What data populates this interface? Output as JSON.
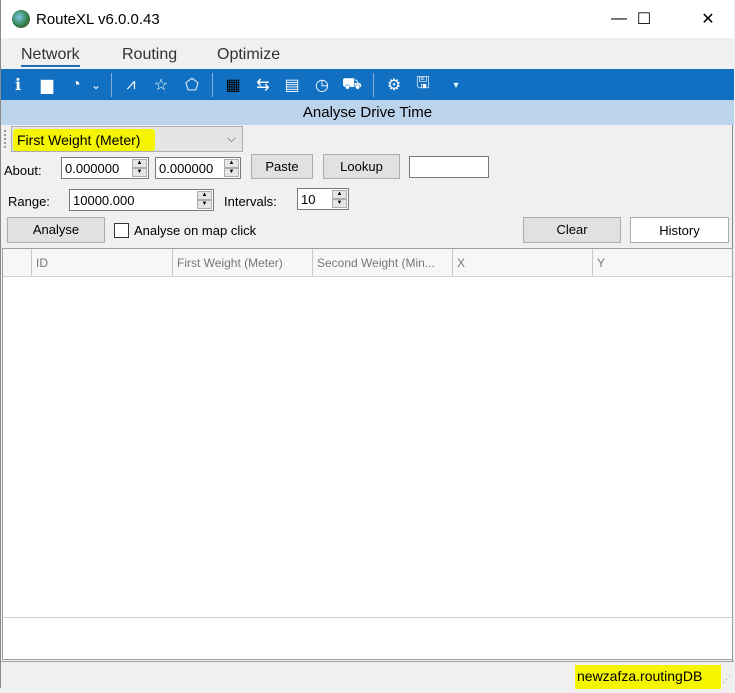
{
  "window": {
    "title": "RouteXL v6.0.0.43",
    "controls": {
      "minimize": "—",
      "maximize": "☐",
      "close": "✕"
    }
  },
  "menu": {
    "tabs": [
      {
        "label": "Network",
        "active": true
      },
      {
        "label": "Routing",
        "active": false
      },
      {
        "label": "Optimize",
        "active": false
      }
    ]
  },
  "toolbar": {
    "icons": [
      {
        "name": "info-icon",
        "glyph": "ℹ"
      },
      {
        "name": "folder-icon",
        "glyph": "▆"
      },
      {
        "name": "gauge-icon",
        "glyph": "◔"
      },
      {
        "name": "dropdown-chevron-icon",
        "glyph": "⌄"
      },
      {
        "name": "road-icon",
        "glyph": "⩘"
      },
      {
        "name": "star-icon",
        "glyph": "☆"
      },
      {
        "name": "polygon-icon",
        "glyph": "⬠"
      },
      {
        "name": "grid-icon",
        "glyph": "▦"
      },
      {
        "name": "group-transfer-icon",
        "glyph": "⇆"
      },
      {
        "name": "document-folder-icon",
        "glyph": "▤"
      },
      {
        "name": "truck-clock-icon",
        "glyph": "◷"
      },
      {
        "name": "truck-icon",
        "glyph": "⛟"
      },
      {
        "name": "settings-icon",
        "glyph": "⚙"
      },
      {
        "name": "save-icon",
        "glyph": "🖫"
      },
      {
        "name": "overflow-chevron-icon",
        "glyph": "▾"
      }
    ]
  },
  "panel": {
    "title": "Analyse Drive Time",
    "weight_select": {
      "value": "First Weight (Meter)"
    },
    "about_label": "About:",
    "about_x": "0.000000",
    "about_y": "0.000000",
    "paste_label": "Paste",
    "lookup_label": "Lookup",
    "lookup_value": "",
    "range_label": "Range:",
    "range_value": "10000.000",
    "intervals_label": "Intervals:",
    "intervals_value": "10",
    "analyse_label": "Analyse",
    "analyse_on_click_label": "Analyse on map click",
    "analyse_on_click_checked": false,
    "clear_label": "Clear",
    "history_label": "History"
  },
  "grid": {
    "columns": [
      "ID",
      "First Weight (Meter)",
      "Second Weight (Min...",
      "X",
      "Y"
    ],
    "rows": []
  },
  "status": {
    "database": "newzafza.routingDB"
  }
}
